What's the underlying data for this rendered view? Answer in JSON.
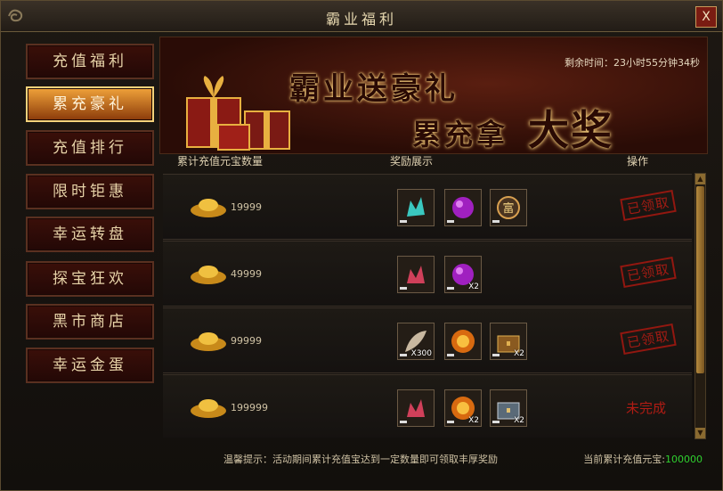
{
  "window": {
    "title": "霸业福利",
    "close_label": "X"
  },
  "sidebar": {
    "items": [
      {
        "label": "充值福利",
        "active": false
      },
      {
        "label": "累充豪礼",
        "active": true
      },
      {
        "label": "充值排行",
        "active": false
      },
      {
        "label": "限时钜惠",
        "active": false
      },
      {
        "label": "幸运转盘",
        "active": false
      },
      {
        "label": "探宝狂欢",
        "active": false
      },
      {
        "label": "黑市商店",
        "active": false
      },
      {
        "label": "幸运金蛋",
        "active": false
      }
    ]
  },
  "banner": {
    "line1": "霸业送豪礼",
    "line2a": "累充拿",
    "line2b": "大奖",
    "countdown": "剩余时间：23小时55分钟34秒"
  },
  "columns": {
    "amount": "累计充值元宝数量",
    "rewards": "奖励展示",
    "action": "操作"
  },
  "rows": [
    {
      "amount": "19999",
      "status": "已领取",
      "claimed": true,
      "items": [
        {
          "icon": "cyan-crystal-icon",
          "qty": ""
        },
        {
          "icon": "purple-orb-icon",
          "qty": ""
        },
        {
          "icon": "fortune-badge-icon",
          "qty": ""
        }
      ]
    },
    {
      "amount": "49999",
      "status": "已领取",
      "claimed": true,
      "items": [
        {
          "icon": "red-crystal-icon",
          "qty": ""
        },
        {
          "icon": "purple-orb-icon",
          "qty": "X2"
        }
      ]
    },
    {
      "amount": "99999",
      "status": "已领取",
      "claimed": true,
      "items": [
        {
          "icon": "feather-icon",
          "qty": "X300"
        },
        {
          "icon": "fire-orb-icon",
          "qty": ""
        },
        {
          "icon": "treasure-chest-icon",
          "qty": "X2"
        }
      ]
    },
    {
      "amount": "199999",
      "status": "未完成",
      "claimed": false,
      "items": [
        {
          "icon": "red-crystal-icon",
          "qty": ""
        },
        {
          "icon": "fire-orb-icon",
          "qty": "X2"
        },
        {
          "icon": "silver-chest-icon",
          "qty": "X2"
        }
      ]
    }
  ],
  "footer": {
    "tip": "温馨提示：活动期间累计充值宝达到一定数量即可领取丰厚奖励",
    "total_label": "当前累计充值元宝:",
    "total_value": "100000"
  },
  "colors": {
    "accent_gold": "#f0a23a",
    "stamp_red": "#b01c14",
    "value_green": "#2fd12f"
  }
}
